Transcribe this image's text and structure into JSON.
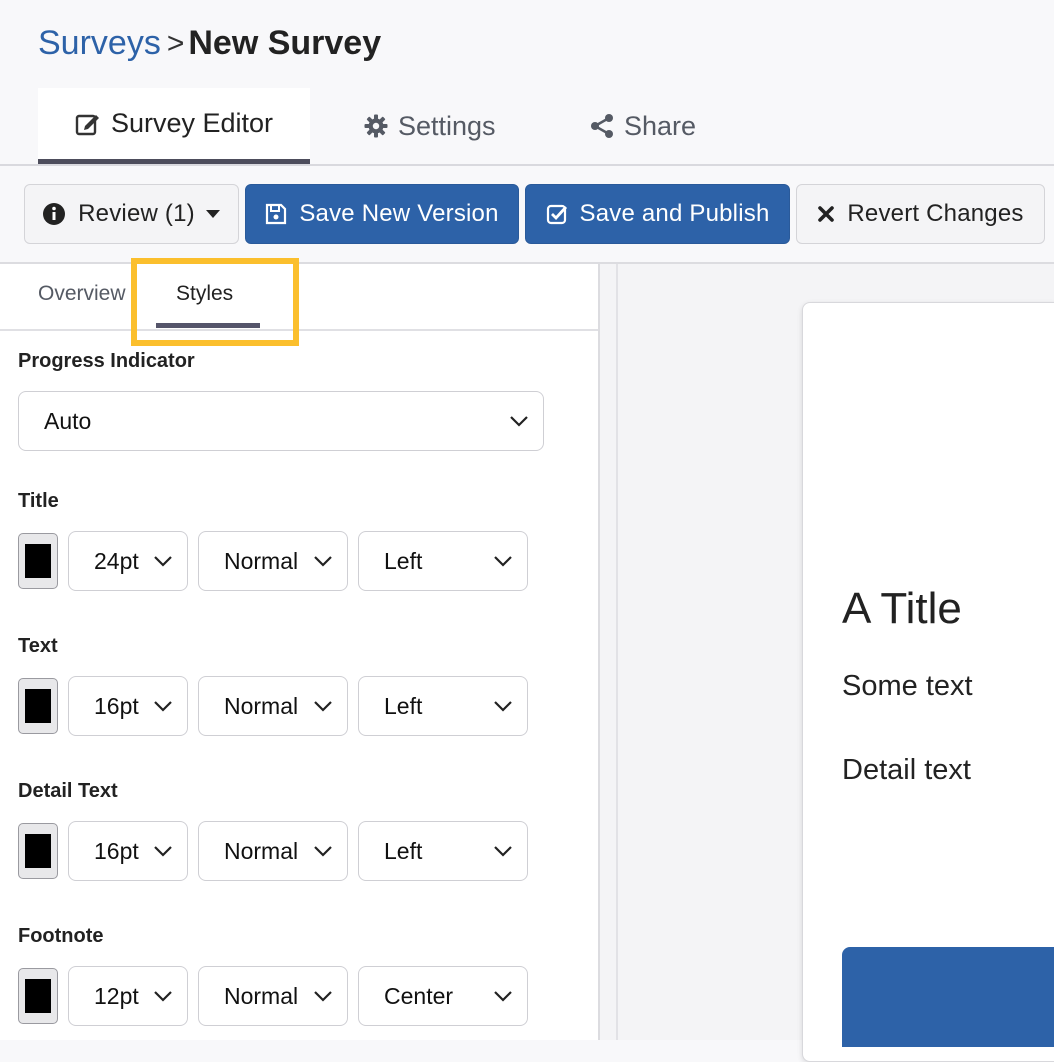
{
  "breadcrumb": {
    "parent": "Surveys",
    "separator": ">",
    "current": "New Survey"
  },
  "top_tabs": [
    {
      "label": "Survey Editor",
      "icon": "edit-icon",
      "active": true
    },
    {
      "label": "Settings",
      "icon": "gear-icon",
      "active": false
    },
    {
      "label": "Share",
      "icon": "share-icon",
      "active": false
    }
  ],
  "toolbar": {
    "review_label": "Review (1)",
    "save_version_label": "Save New Version",
    "save_publish_label": "Save and Publish",
    "revert_label": "Revert Changes"
  },
  "panel_tabs": {
    "overview": "Overview",
    "styles": "Styles",
    "active": "Styles"
  },
  "styles": {
    "progress_label": "Progress Indicator",
    "progress_value": "Auto",
    "groups": [
      {
        "label": "Title",
        "color": "#000000",
        "size": "24pt",
        "weight": "Normal",
        "align": "Left"
      },
      {
        "label": "Text",
        "color": "#000000",
        "size": "16pt",
        "weight": "Normal",
        "align": "Left"
      },
      {
        "label": "Detail Text",
        "color": "#000000",
        "size": "16pt",
        "weight": "Normal",
        "align": "Left"
      },
      {
        "label": "Footnote",
        "color": "#000000",
        "size": "12pt",
        "weight": "Normal",
        "align": "Center"
      }
    ]
  },
  "preview": {
    "title": "A Title",
    "text": "Some text",
    "detail": "Detail text"
  },
  "colors": {
    "accent": "#2d62a8",
    "highlight": "#fbbf2d"
  }
}
